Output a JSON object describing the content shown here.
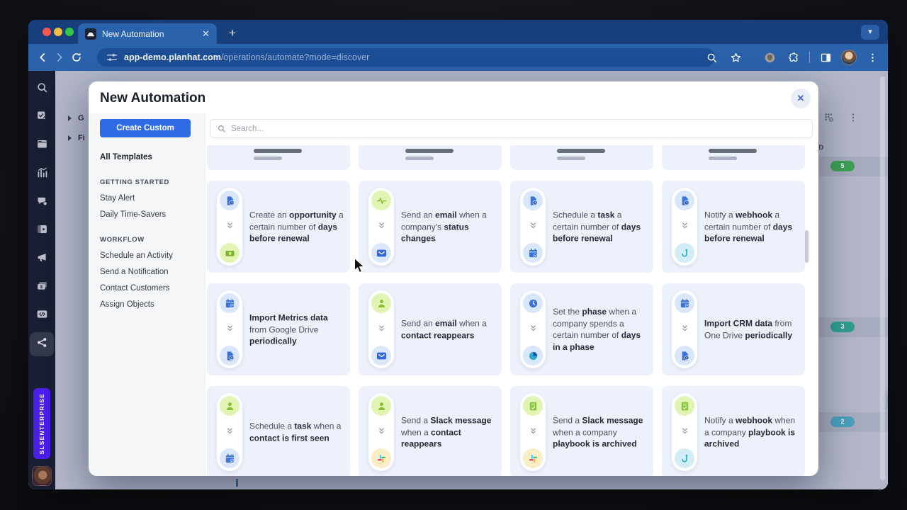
{
  "browser": {
    "tab": {
      "title": "New Automation",
      "favicon": "planhat-favicon",
      "close_icon": "tab-close-icon"
    },
    "new_tab_label": "+",
    "tab_chevron_icon": "chevron-down-icon",
    "url": {
      "domain": "app-demo.planhat.com",
      "path": "/operations/automate?mode=discover"
    },
    "toolbar_icons": [
      "back-icon",
      "forward-icon",
      "reload-icon",
      "site-settings-icon",
      "zoom-icon",
      "bookmark-star-icon",
      "adblock-badge-icon",
      "extensions-puzzle-icon",
      "side-panel-icon",
      "profile-avatar",
      "kebab-menu-icon"
    ]
  },
  "app_sidebar": {
    "workspace": "SLSENTERPRISE",
    "items": [
      {
        "name": "search",
        "icon": "search-icon",
        "active": false
      },
      {
        "name": "tasks",
        "icon": "tasks-icon",
        "active": false
      },
      {
        "name": "portal",
        "icon": "window-icon",
        "active": false
      },
      {
        "name": "analytics",
        "icon": "analytics-icon",
        "active": false
      },
      {
        "name": "conversations",
        "icon": "chat-icon",
        "active": false
      },
      {
        "name": "media-panel",
        "icon": "panel-play-icon",
        "active": false
      },
      {
        "name": "campaigns",
        "icon": "megaphone-icon",
        "active": false
      },
      {
        "name": "revenue",
        "icon": "money-card-icon",
        "active": false
      },
      {
        "name": "developer",
        "icon": "code-icon",
        "active": false
      },
      {
        "name": "automations",
        "icon": "automation-icon",
        "active": true
      }
    ]
  },
  "page_background": {
    "tree_items": [
      "G",
      "Fi"
    ],
    "header_icons": [
      "board-settings-icon",
      "kebab-menu-icon"
    ],
    "column_header": "ND",
    "badges": [
      {
        "value": "5",
        "color": "#3da055"
      },
      {
        "value": "3",
        "color": "#2f9e8f"
      },
      {
        "value": "2",
        "color": "#4aa0bd"
      }
    ],
    "chat_button_icon": "chat-bubbles-icon"
  },
  "modal": {
    "title": "New Automation",
    "close_icon": "close-icon",
    "create_button_label": "Create Custom",
    "create_button_color": "#2f6be4",
    "all_templates_label": "All Templates",
    "search_placeholder": "Search...",
    "nav_sections": [
      {
        "heading": "GETTING STARTED",
        "items": [
          "Stay Alert",
          "Daily Time-Savers"
        ]
      },
      {
        "heading": "WORKFLOW",
        "items": [
          "Schedule an Activity",
          "Send a Notification",
          "Contact Customers",
          "Assign Objects"
        ]
      }
    ],
    "cards": [
      {
        "trigger_icon": "renewal-document-icon",
        "action_icon": "opportunity-money-icon",
        "segments": [
          {
            "t": "Create an ",
            "b": false
          },
          {
            "t": "opportunity",
            "b": true
          },
          {
            "t": " a certain number of ",
            "b": false
          },
          {
            "t": "days before renewal",
            "b": true
          }
        ]
      },
      {
        "trigger_icon": "status-pulse-icon",
        "action_icon": "email-icon",
        "segments": [
          {
            "t": "Send an ",
            "b": false
          },
          {
            "t": "email",
            "b": true
          },
          {
            "t": " when a company's ",
            "b": false
          },
          {
            "t": "status changes",
            "b": true
          }
        ]
      },
      {
        "trigger_icon": "renewal-document-icon",
        "action_icon": "task-calendar-icon",
        "segments": [
          {
            "t": "Schedule a ",
            "b": false
          },
          {
            "t": "task",
            "b": true
          },
          {
            "t": " a certain number of ",
            "b": false
          },
          {
            "t": "days before renewal",
            "b": true
          }
        ]
      },
      {
        "trigger_icon": "renewal-document-icon",
        "action_icon": "webhook-icon",
        "segments": [
          {
            "t": "Notify a ",
            "b": false
          },
          {
            "t": "webhook",
            "b": true
          },
          {
            "t": " a certain number of ",
            "b": false
          },
          {
            "t": "days before renewal",
            "b": true
          }
        ]
      },
      {
        "trigger_icon": "schedule-calendar-icon",
        "action_icon": "import-document-icon",
        "segments": [
          {
            "t": "Import Metrics data",
            "b": true
          },
          {
            "t": " from Google Drive ",
            "b": false
          },
          {
            "t": "periodically",
            "b": true
          }
        ]
      },
      {
        "trigger_icon": "contact-person-icon",
        "action_icon": "email-icon",
        "segments": [
          {
            "t": "Send an ",
            "b": false
          },
          {
            "t": "email",
            "b": true
          },
          {
            "t": " when a ",
            "b": false
          },
          {
            "t": "contact reappears",
            "b": true
          }
        ]
      },
      {
        "trigger_icon": "time-clock-icon",
        "action_icon": "phase-icon",
        "segments": [
          {
            "t": "Set the ",
            "b": false
          },
          {
            "t": "phase",
            "b": true
          },
          {
            "t": " when a company spends a certain number of ",
            "b": false
          },
          {
            "t": "days in a phase",
            "b": true
          }
        ]
      },
      {
        "trigger_icon": "schedule-calendar-icon",
        "action_icon": "import-document-icon",
        "segments": [
          {
            "t": "Import CRM data",
            "b": true
          },
          {
            "t": " from One Drive ",
            "b": false
          },
          {
            "t": "periodically",
            "b": true
          }
        ]
      },
      {
        "trigger_icon": "contact-person-icon",
        "action_icon": "task-calendar-icon",
        "segments": [
          {
            "t": "Schedule a ",
            "b": false
          },
          {
            "t": "task",
            "b": true
          },
          {
            "t": " when a ",
            "b": false
          },
          {
            "t": "contact is first seen",
            "b": true
          }
        ]
      },
      {
        "trigger_icon": "contact-person-icon",
        "action_icon": "slack-icon",
        "segments": [
          {
            "t": "Send a ",
            "b": false
          },
          {
            "t": "Slack message",
            "b": true
          },
          {
            "t": " when a ",
            "b": false
          },
          {
            "t": "contact reappears",
            "b": true
          }
        ]
      },
      {
        "trigger_icon": "playbook-icon",
        "action_icon": "slack-icon",
        "segments": [
          {
            "t": "Send a ",
            "b": false
          },
          {
            "t": "Slack message",
            "b": true
          },
          {
            "t": " when a company ",
            "b": false
          },
          {
            "t": "playbook is archived",
            "b": true
          }
        ]
      },
      {
        "trigger_icon": "playbook-icon",
        "action_icon": "webhook-icon",
        "segments": [
          {
            "t": "Notify a ",
            "b": false
          },
          {
            "t": "webhook",
            "b": true
          },
          {
            "t": " when a company ",
            "b": false
          },
          {
            "t": "playbook is archived",
            "b": true
          }
        ]
      }
    ]
  }
}
